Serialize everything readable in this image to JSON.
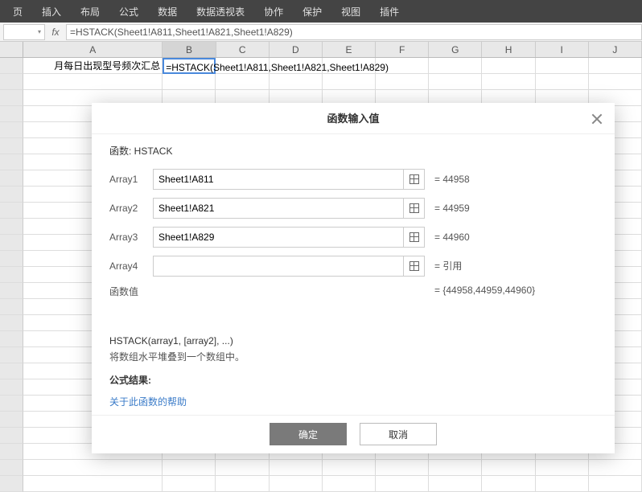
{
  "menu": [
    "页",
    "插入",
    "布局",
    "公式",
    "数据",
    "数据透视表",
    "协作",
    "保护",
    "视图",
    "插件"
  ],
  "formulaBar": {
    "fx": "fx",
    "formula": "=HSTACK(Sheet1!A811,Sheet1!A821,Sheet1!A829)"
  },
  "columns": [
    "A",
    "B",
    "C",
    "D",
    "E",
    "F",
    "G",
    "H",
    "I",
    "J"
  ],
  "cellA1": "月每日出现型号频次汇总",
  "cellB1Formula": "=HSTACK(Sheet1!A811,Sheet1!A821,Sheet1!A829)",
  "dialog": {
    "title": "函数输入值",
    "funcLabel": "函数: HSTACK",
    "args": [
      {
        "label": "Array1",
        "value": "Sheet1!A811",
        "result": "= 44958"
      },
      {
        "label": "Array2",
        "value": "Sheet1!A821",
        "result": "= 44959"
      },
      {
        "label": "Array3",
        "value": "Sheet1!A829",
        "result": "= 44960"
      },
      {
        "label": "Array4",
        "value": "",
        "result": "= 引用"
      }
    ],
    "funcValueLabel": "函数值",
    "funcValueResult": "= {44958,44959,44960}",
    "syntax": "HSTACK(array1, [array2], ...)",
    "description": "将数组水平堆叠到一个数组中。",
    "resultLabel": "公式结果:",
    "helpLink": "关于此函数的帮助",
    "ok": "确定",
    "cancel": "取消"
  }
}
